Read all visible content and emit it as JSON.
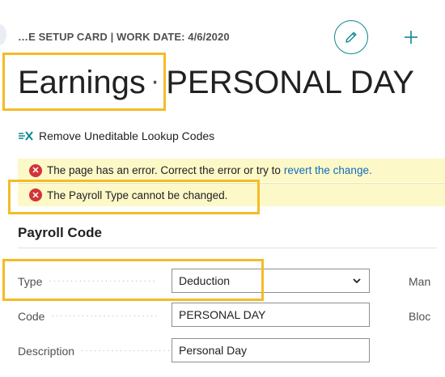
{
  "header": {
    "breadcrumb": "…E SETUP CARD | WORK DATE: 4/6/2020",
    "title_part1": "Earnings",
    "title_separator": "·",
    "title_part2": "PERSONAL DAY"
  },
  "actions": {
    "remove_lookup_label": "Remove Uneditable Lookup Codes"
  },
  "errors": {
    "page_error_text": "The page has an error. Correct the error or try to",
    "page_error_link": "revert the change.",
    "payroll_type_error": "The Payroll Type cannot be changed."
  },
  "section": {
    "title": "Payroll Code"
  },
  "fields": {
    "type_label": "Type",
    "type_value": "Deduction",
    "code_label": "Code",
    "code_value": "PERSONAL DAY",
    "description_label": "Description",
    "description_value": "Personal Day",
    "right_label_1": "Man",
    "right_label_2": "Bloc"
  },
  "colors": {
    "accent": "#0f8591",
    "highlight": "#f5bb27",
    "error_bg": "#fdf8c8",
    "error_icon": "#d13438",
    "link": "#0f6cbd"
  }
}
